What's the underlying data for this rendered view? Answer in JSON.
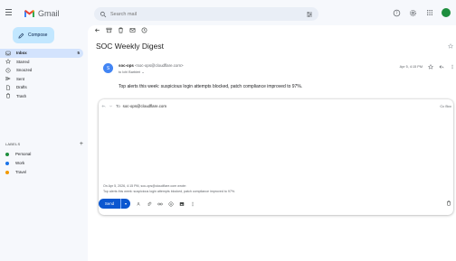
{
  "app": {
    "name": "Gmail"
  },
  "search": {
    "placeholder": "Search mail"
  },
  "compose": {
    "label": "Compose"
  },
  "nav": [
    {
      "label": "Inbox",
      "count": "5",
      "icon": "inbox-icon",
      "active": true
    },
    {
      "label": "Starred",
      "count": "",
      "icon": "star-icon"
    },
    {
      "label": "Snoozed",
      "count": "",
      "icon": "clock-icon"
    },
    {
      "label": "Sent",
      "count": "",
      "icon": "send-icon"
    },
    {
      "label": "Drafts",
      "count": "",
      "icon": "draft-icon"
    },
    {
      "label": "Trash",
      "count": "",
      "icon": "trash-icon"
    }
  ],
  "labels": {
    "heading": "LABELS",
    "items": [
      {
        "label": "Personal",
        "color": "#1e8e3e"
      },
      {
        "label": "Work",
        "color": "#1a73e8"
      },
      {
        "label": "Travel",
        "color": "#f29900"
      }
    ]
  },
  "message": {
    "subject": "SOC Weekly Digest",
    "avatar_letter": "S",
    "sender_name": "soc-ops",
    "sender_email": "<soc-ops@cloudflare.com>",
    "to_line": "to Ichi Barbieri ⌄",
    "date": "Apr 5, 4:15 PM",
    "body": "Top alerts this week: suspicious login attempts blocked, patch compliance improved to 97%."
  },
  "reply": {
    "to_prefix": "To",
    "recipient": "soc-ops@cloudflare.com",
    "cc_bcc": "Cc  Bcc",
    "quote_header": "On Apr 5, 2026, 4:15 PM, soc-ops@cloudflare.com wrote:",
    "quote_body": "Top alerts this week: suspicious login attempts blocked, patch compliance improved to 97%.",
    "send_label": "Send"
  },
  "colors": {
    "accent": "#0b57d0",
    "compose_bg": "#c2e7ff",
    "active_nav": "#d3e3fd"
  }
}
